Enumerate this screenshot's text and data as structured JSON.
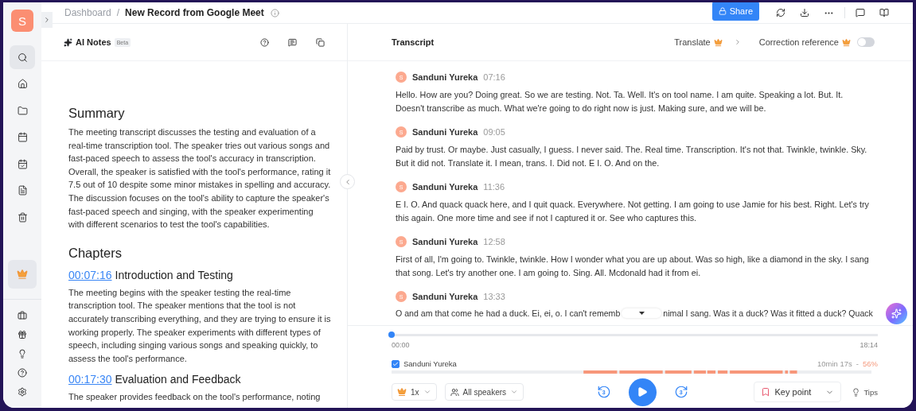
{
  "user": {
    "initial": "S"
  },
  "sidebar": {
    "items": [
      {
        "selected": true
      },
      {
        "selected": false
      },
      {
        "selected": false
      },
      {
        "selected": false
      },
      {
        "selected": false
      },
      {
        "selected": false
      },
      {
        "selected": false
      }
    ]
  },
  "breadcrumb": {
    "parent": "Dashboard",
    "separator": "/",
    "current": "New Record from Google Meet"
  },
  "toolbar": {
    "share": "Share"
  },
  "notes": {
    "title": "AI Notes",
    "badge": "Beta",
    "summary_heading": "Summary",
    "summary": "The meeting transcript discusses the testing and evaluation of a real-time transcription tool. The speaker tries out various songs and fast-paced speech to assess the tool's accuracy in transcription. Overall, the speaker is satisfied with the tool's performance, rating it 7.5 out of 10 despite some minor mistakes in spelling and accuracy. The discussion focuses on the tool's ability to capture the speaker's fast-paced speech and singing, with the speaker experimenting with different scenarios to test the tool's capabilities.",
    "chapters_heading": "Chapters",
    "chapters": [
      {
        "time": "00:07:16",
        "title": "Introduction and Testing",
        "text": "The meeting begins with the speaker testing the real-time transcription tool. The speaker mentions that the tool is not accurately transcribing everything, and they are trying to ensure it is working properly. The speaker experiments with different types of speech, including singing various songs and speaking quickly, to assess the tool's performance."
      },
      {
        "time": "00:17:30",
        "title": "Evaluation and Feedback",
        "text": "The speaker provides feedback on the tool's performance, noting"
      }
    ]
  },
  "transcript": {
    "title": "Transcript",
    "translate": "Translate",
    "correction": {
      "label": "Correction reference",
      "on": false
    },
    "segments": [
      {
        "initial": "S",
        "speaker": "Sanduni Yureka",
        "time": "07:16",
        "text": "Hello. How are you? Doing great. So we are testing. Not. Ta. Well. It's on tool name. I am quite. Speaking a lot. But. It. Doesn't transcribe as much. What we're going to do right now is just. Making sure, and we will be."
      },
      {
        "initial": "S",
        "speaker": "Sanduni Yureka",
        "time": "09:05",
        "text": "Paid by trust. Or maybe. Just casually, I guess. I never said. The. Real time. Transcription. It's not that. Twinkle, twinkle. Sky. But it did not. Translate it. I mean, trans. I. Did not. E I. O. And on the."
      },
      {
        "initial": "S",
        "speaker": "Sanduni Yureka",
        "time": "11:36",
        "text": "E I. O. And quack quack here, and I quit quack. Everywhere. Not getting. I am going to use Jamie for his best. Right. Let's try this again. One more time and see if not I captured it or. See who captures this."
      },
      {
        "initial": "S",
        "speaker": "Sanduni Yureka",
        "time": "12:58",
        "text": "First of all, I'm going to. Twinkle, twinkle. How I wonder what you are up about. Was so high, like a diamond in the sky. I sang that song. Let's try another one. I am going to. Sing. All. Mcdonald had it from ei."
      },
      {
        "initial": "S",
        "speaker": "Sanduni Yureka",
        "time": "13:33",
        "text_before": "O and am that come he had a duck. Ei, ei, o. I can't rememb",
        "text_after": "nimal I sang. Was it a duck? Was it fitted a duck? Quack"
      }
    ]
  },
  "player": {
    "level": 0,
    "start": "00:00",
    "end": "18:14",
    "speaker": {
      "name": "Sanduni Yureka",
      "checked": true,
      "duration": "10min 17s",
      "separator": "-",
      "share": "56%"
    },
    "speed": "1x",
    "speakers_filter": "All speakers",
    "skip_back": "3",
    "skip_forward": "3",
    "key_point": "Key point",
    "tips": "Tips"
  }
}
